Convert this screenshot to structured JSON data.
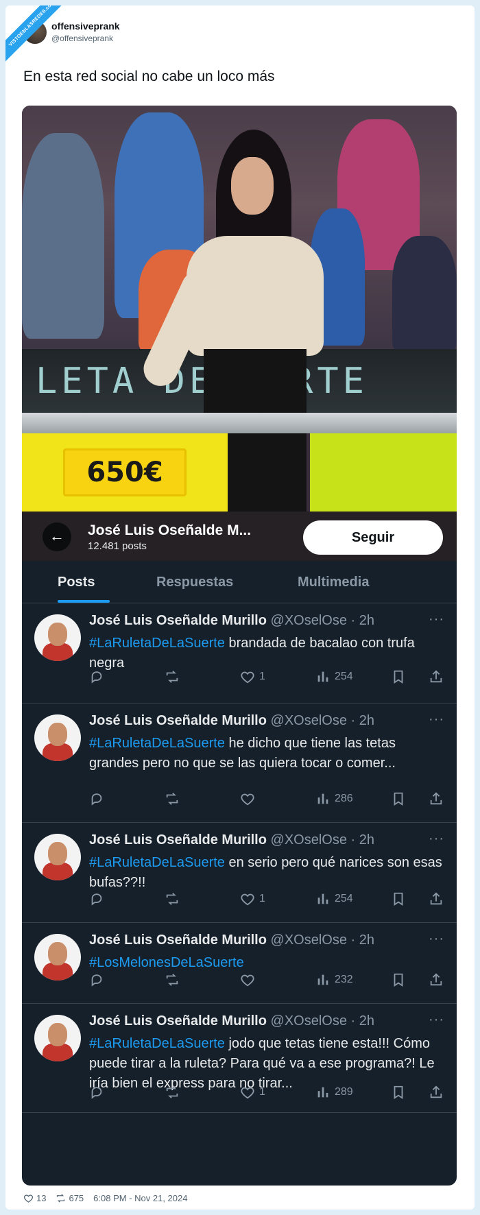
{
  "watermark": "VISTOENLASREDES",
  "watermark_sub": ".com",
  "tweet": {
    "author_name": "offensiveprank",
    "author_handle": "@offensiveprank",
    "text": "En esta red social no cabe un loco más",
    "likes": "13",
    "retweets": "675",
    "timestamp": "6:08 PM - Nov 21, 2024"
  },
  "photo": {
    "sign_text": "LETA DE L    RTE",
    "price": "650€"
  },
  "profile": {
    "name": "José Luis Oseñalde M...",
    "posts_count": "12.481 posts",
    "follow_label": "Seguir"
  },
  "tabs": [
    "Posts",
    "Respuestas",
    "Multimedia"
  ],
  "posts": [
    {
      "name": "José Luis Oseñalde Murillo",
      "handle": "@XOselOse · 2h",
      "hashtag": "#LaRuletaDeLaSuerte",
      "text": " brandada de bacalao con trufa negra",
      "likes": "1",
      "views": "254"
    },
    {
      "name": "José Luis Oseñalde Murillo",
      "handle": "@XOselOse · 2h",
      "hashtag": "#LaRuletaDeLaSuerte",
      "text": " he dicho que tiene las tetas grandes pero no que se las quiera tocar o comer...",
      "likes": "",
      "views": "286"
    },
    {
      "name": "José Luis Oseñalde Murillo",
      "handle": "@XOselOse · 2h",
      "hashtag": "#LaRuletaDeLaSuerte",
      "text": " en serio pero qué narices son esas bufas??!!",
      "likes": "1",
      "views": "254"
    },
    {
      "name": "José Luis Oseñalde Murillo",
      "handle": "@XOselOse · 2h",
      "hashtag": "#LosMelonesDeLaSuerte",
      "text": "",
      "likes": "",
      "views": "232"
    },
    {
      "name": "José Luis Oseñalde Murillo",
      "handle": "@XOselOse · 2h",
      "hashtag": "#LaRuletaDeLaSuerte",
      "text": " jodo que tetas tiene esta!!! Cómo puede tirar a la ruleta? Para qué va a ese programa?! Le iría bien el express para no tirar...",
      "likes": "1",
      "views": "289"
    }
  ],
  "colors": {
    "accent": "#1d9bf0",
    "dark_bg": "#15202b",
    "watermark": "#2aa3ef"
  }
}
